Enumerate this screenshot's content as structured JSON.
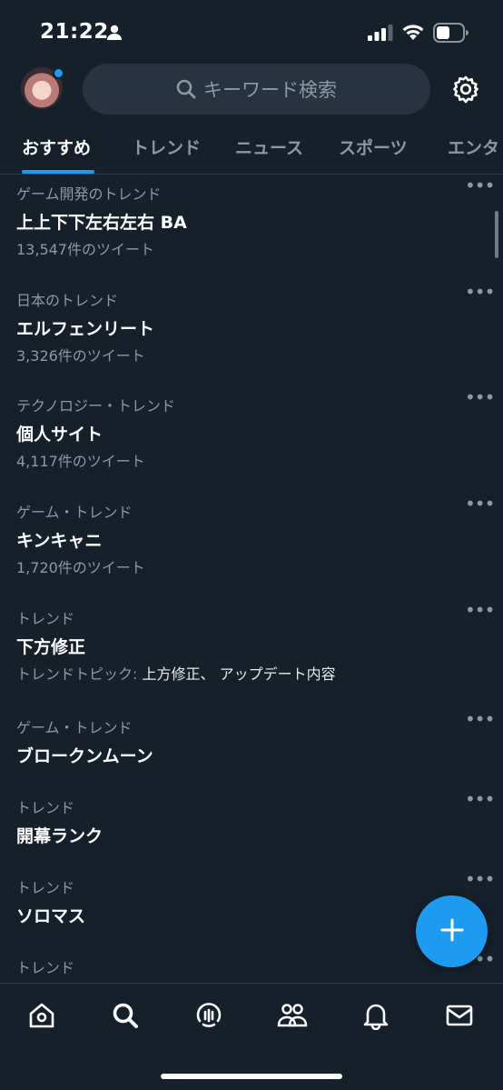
{
  "status_bar": {
    "time": "21:22"
  },
  "header": {
    "search_placeholder": "キーワード検索"
  },
  "tabs": [
    {
      "label": "おすすめ",
      "active": true
    },
    {
      "label": "トレンド",
      "active": false
    },
    {
      "label": "ニュース",
      "active": false
    },
    {
      "label": "スポーツ",
      "active": false
    },
    {
      "label": "エンタ",
      "active": false
    }
  ],
  "trends": [
    {
      "category": "ゲーム開発のトレンド",
      "name": "上上下下左右左右 BA",
      "sub": "13,547件のツイート"
    },
    {
      "category": "日本のトレンド",
      "name": "エルフェンリート",
      "sub": "3,326件のツイート"
    },
    {
      "category": "テクノロジー・トレンド",
      "name": "個人サイト",
      "sub": "4,117件のツイート"
    },
    {
      "category": "ゲーム・トレンド",
      "name": "キンキャニ",
      "sub": "1,720件のツイート"
    },
    {
      "category": "トレンド",
      "name": "下方修正",
      "sub_prefix": "トレンドトピック: ",
      "sub_topics": "上方修正、 アップデート内容"
    },
    {
      "category": "ゲーム・トレンド",
      "name": "ブロークンムーン"
    },
    {
      "category": "トレンド",
      "name": "開幕ランク"
    },
    {
      "category": "トレンド",
      "name": "ソロマス"
    },
    {
      "category": "トレンド"
    }
  ],
  "more_label": "•••",
  "colors": {
    "background": "#15202b",
    "accent": "#1d9bf0",
    "secondary_text": "#8b98a5",
    "search_bg": "#273340"
  },
  "icons": {
    "status": [
      "person-icon",
      "signal-icon",
      "wifi-icon",
      "battery-icon"
    ],
    "header": [
      "search-icon",
      "gear-icon"
    ],
    "fab": "plus-icon",
    "nav": [
      "home-icon",
      "search-icon",
      "spaces-icon",
      "communities-icon",
      "bell-icon",
      "mail-icon"
    ]
  }
}
